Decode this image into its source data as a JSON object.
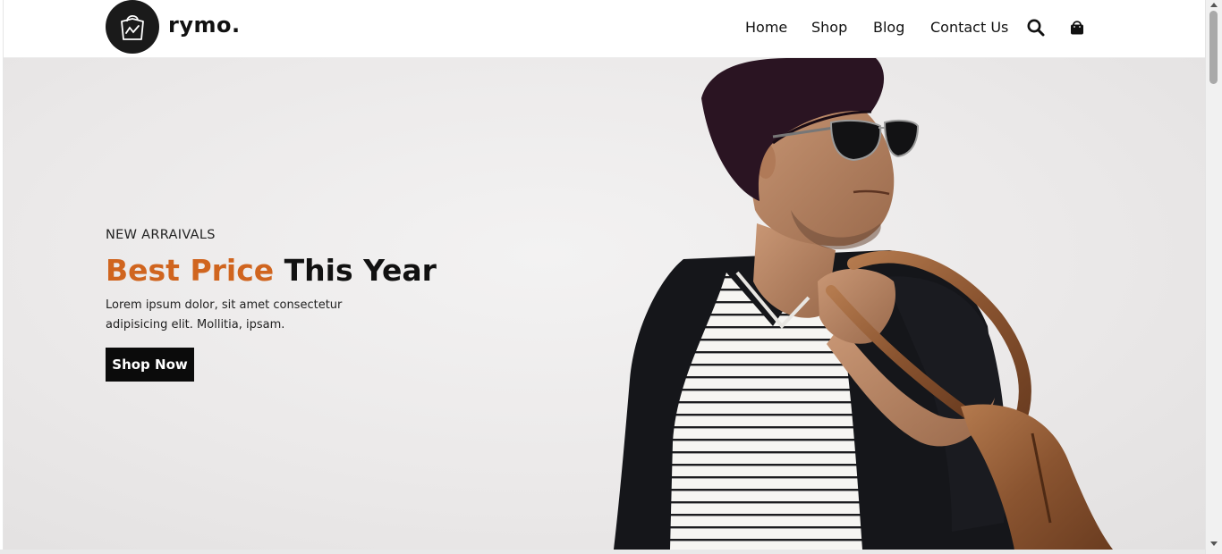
{
  "brand": {
    "name": "rymo."
  },
  "nav": {
    "items": [
      "Home",
      "Shop",
      "Blog",
      "Contact Us"
    ]
  },
  "header_icons": {
    "search": "search-icon",
    "cart": "shopping-bag-icon"
  },
  "hero": {
    "eyebrow": "NEW ARRAIVALS",
    "title_accent": "Best Price",
    "title_rest": "This Year",
    "description": "Lorem ipsum dolor, sit amet consectetur adipisicing elit. Mollitia, ipsam.",
    "cta_label": "Shop Now"
  },
  "colors": {
    "accent": "#d0651f",
    "dark": "#0b0b0b",
    "hero_bg": "#ebe9e9"
  }
}
